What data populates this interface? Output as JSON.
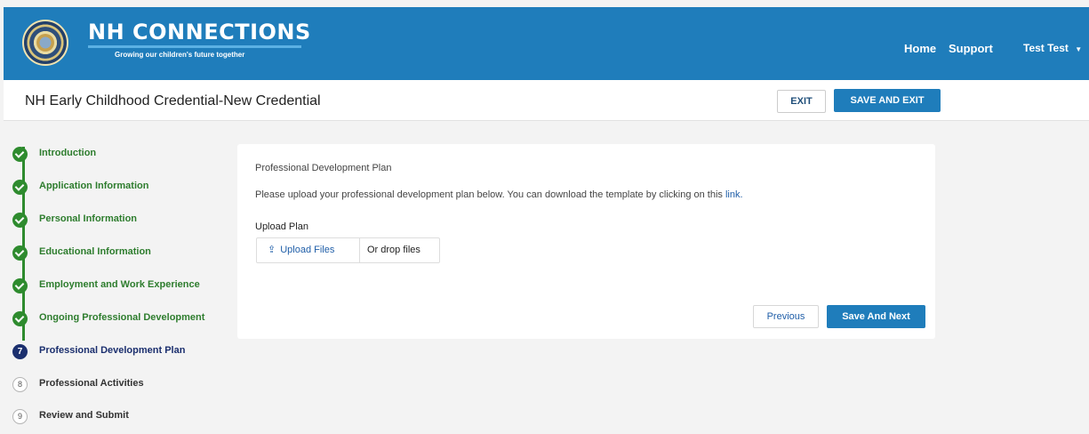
{
  "header": {
    "brand_title": "NH CONNECTIONS",
    "brand_tagline": "Growing our children's future together",
    "nav": {
      "home": "Home",
      "support": "Support",
      "user": "Test Test"
    },
    "colors": {
      "primary": "#1f7dbb"
    }
  },
  "titlebar": {
    "title": "NH Early Childhood Credential-New Credential",
    "exit_label": "EXIT",
    "save_exit_label": "SAVE AND EXIT"
  },
  "steps": [
    {
      "label": "Introduction",
      "status": "complete"
    },
    {
      "label": "Application Information",
      "status": "complete"
    },
    {
      "label": "Personal Information",
      "status": "complete"
    },
    {
      "label": "Educational Information",
      "status": "complete"
    },
    {
      "label": "Employment and Work Experience",
      "status": "complete"
    },
    {
      "label": "Ongoing Professional Development",
      "status": "complete"
    },
    {
      "label": "Professional Development Plan",
      "status": "current",
      "number": "7"
    },
    {
      "label": "Professional Activities",
      "status": "pending",
      "number": "8"
    },
    {
      "label": "Review and Submit",
      "status": "pending",
      "number": "9"
    }
  ],
  "card": {
    "section_title": "Professional Development Plan",
    "instructions": "Please upload your professional development plan below. You can download the template by clicking on this",
    "link_text": "link.",
    "upload_label": "Upload Plan",
    "upload_button": "Upload Files",
    "drop_text": "Or drop files",
    "previous_label": "Previous",
    "next_label": "Save And Next"
  }
}
